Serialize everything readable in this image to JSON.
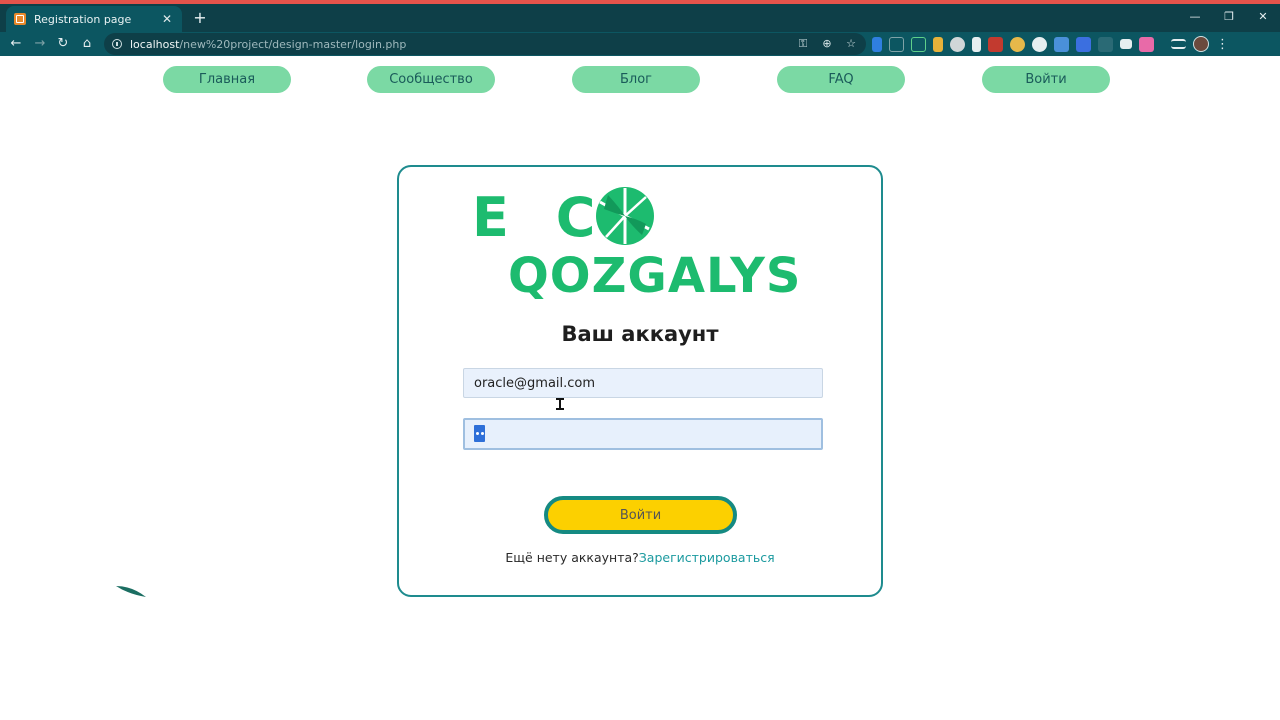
{
  "browser": {
    "tab_title": "Registration page",
    "tab_close": "✕",
    "new_tab": "+",
    "url_host": "localhost",
    "url_path": "/new%20project/design-master/login.php",
    "window_controls": {
      "minimize": "—",
      "restore": "❐",
      "close": "✕"
    }
  },
  "nav": {
    "items": [
      {
        "label": "Главная"
      },
      {
        "label": "Сообщество"
      },
      {
        "label": "Блог"
      },
      {
        "label": "FAQ"
      },
      {
        "label": "Войти"
      }
    ]
  },
  "logo": {
    "line1": "E C",
    "line2": "QOZGALYS"
  },
  "form": {
    "title": "Ваш аккаунт",
    "email_value": "oracle@gmail.com",
    "submit_label": "Войти",
    "signup_prompt": "Ещё нету аккаунта?",
    "signup_link": "Зарегистрироваться"
  },
  "colors": {
    "chrome_dark": "#0e3f48",
    "chrome_toolbar": "#0c5661",
    "nav_pill": "#7bd9a4",
    "card_border": "#1e8b8e",
    "logo_green": "#1dbb6f",
    "button_yellow": "#fcd000",
    "link_teal": "#1b9a9f"
  }
}
